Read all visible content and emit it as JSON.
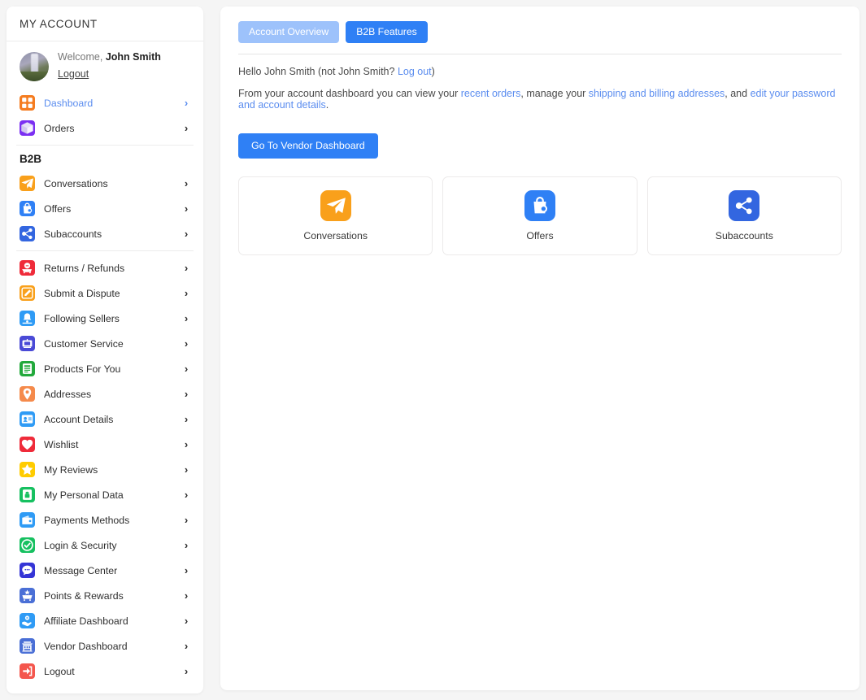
{
  "sidebar": {
    "title": "MY ACCOUNT",
    "profile": {
      "welcome_prefix": "Welcome,",
      "user_name": "John Smith",
      "logout_label": "Logout",
      "avatar_alt": "user-avatar-photo"
    },
    "section_label": "B2B",
    "chevron": "›",
    "items_top": [
      {
        "label": "Dashboard",
        "icon": "grid-icon",
        "color": "#f57c20",
        "active": true
      },
      {
        "label": "Orders",
        "icon": "box-icon",
        "color": "#7b2ff2",
        "active": false
      }
    ],
    "items_b2b": [
      {
        "label": "Conversations",
        "icon": "paper-plane-icon",
        "color": "#f9a01b",
        "active": false
      },
      {
        "label": "Offers",
        "icon": "shopping-bag-tag-icon",
        "color": "#2f80f5",
        "active": false
      },
      {
        "label": "Subaccounts",
        "icon": "share-nodes-icon",
        "color": "#3366e0",
        "active": false
      }
    ],
    "items_rest": [
      {
        "label": "Returns / Refunds",
        "icon": "return-cart-icon",
        "color": "#ef2b3a",
        "active": false
      },
      {
        "label": "Submit a Dispute",
        "icon": "pencil-edit-icon",
        "color": "#f9a01b",
        "active": false
      },
      {
        "label": "Following Sellers",
        "icon": "bell-store-icon",
        "color": "#2f9bf5",
        "active": false
      },
      {
        "label": "Customer Service",
        "icon": "headset-support-icon",
        "color": "#4a4ad6",
        "active": false
      },
      {
        "label": "Products For You",
        "icon": "product-list-icon",
        "color": "#22a93c",
        "active": false
      },
      {
        "label": "Addresses",
        "icon": "map-pin-icon",
        "color": "#f58a4b",
        "active": false
      },
      {
        "label": "Account Details",
        "icon": "id-card-icon",
        "color": "#2f9bf5",
        "active": false
      },
      {
        "label": "Wishlist",
        "icon": "heart-icon",
        "color": "#ef2b3a",
        "active": false
      },
      {
        "label": "My Reviews",
        "icon": "star-icon",
        "color": "#ffcc00",
        "active": false
      },
      {
        "label": "My Personal Data",
        "icon": "data-lock-icon",
        "color": "#16c060",
        "active": false
      },
      {
        "label": "Payments Methods",
        "icon": "wallet-icon",
        "color": "#2f9bf5",
        "active": false
      },
      {
        "label": "Login & Security",
        "icon": "check-shield-icon",
        "color": "#16c060",
        "active": false
      },
      {
        "label": "Message Center",
        "icon": "chat-bubble-icon",
        "color": "#3535d6",
        "active": false
      },
      {
        "label": "Points & Rewards",
        "icon": "reward-cart-icon",
        "color": "#4a6fd6",
        "active": false
      },
      {
        "label": "Affiliate Dashboard",
        "icon": "handshake-coin-icon",
        "color": "#2f9bf5",
        "active": false
      },
      {
        "label": "Vendor Dashboard",
        "icon": "store-building-icon",
        "color": "#4a6fd6",
        "active": false
      },
      {
        "label": "Logout",
        "icon": "logout-arrow-icon",
        "color": "#f4564d",
        "active": false
      }
    ]
  },
  "main": {
    "tabs": [
      {
        "label": "Account Overview",
        "state": "inactive"
      },
      {
        "label": "B2B Features",
        "state": "active"
      }
    ],
    "hello": {
      "prefix": "Hello John Smith (not John Smith? ",
      "link": "Log out",
      "suffix": ")"
    },
    "intro": {
      "part1": "From your account dashboard you can view your ",
      "link1": "recent orders",
      "part2": ", manage your ",
      "link2": "shipping and billing addresses",
      "part3": ", and ",
      "link3": "edit your password and account details",
      "part4": "."
    },
    "vendor_button": "Go To Vendor Dashboard",
    "cards": [
      {
        "label": "Conversations",
        "icon": "paper-plane-icon",
        "color": "#f9a01b"
      },
      {
        "label": "Offers",
        "icon": "shopping-bag-tag-icon",
        "color": "#2f80f5"
      },
      {
        "label": "Subaccounts",
        "icon": "share-nodes-icon",
        "color": "#3366e0"
      }
    ]
  },
  "colors": {
    "page_bg": "#f5f5f5",
    "card_bg": "#ffffff",
    "accent_blue": "#2f80f5",
    "accent_blue_light": "#9dc2fb",
    "link_blue": "#5b8def",
    "text": "#2f2f2f"
  }
}
